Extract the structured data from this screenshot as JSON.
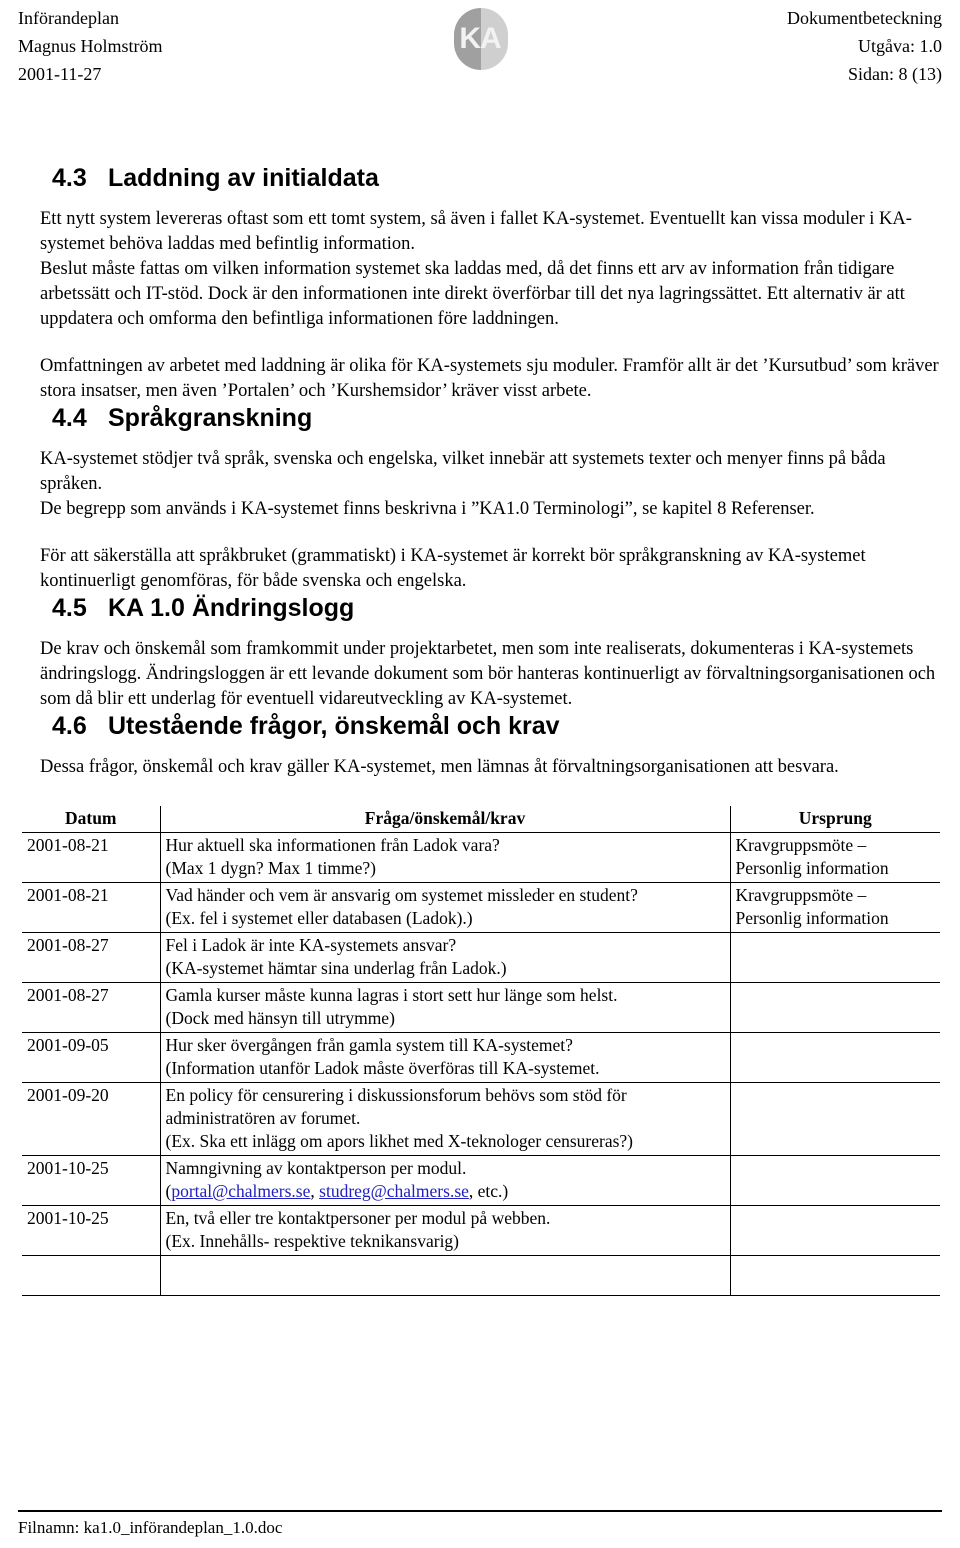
{
  "header": {
    "left_lines": [
      "Införandeplan",
      "Magnus Holmström",
      "2001-11-27"
    ],
    "right_lines": [
      "Dokumentbeteckning",
      "Utgåva: 1.0",
      "Sidan: 8 (13)"
    ],
    "logo_text": "KA",
    "logo_color": "#a0a0a0"
  },
  "sections": [
    {
      "number": "4.3",
      "title": "Laddning av initialdata",
      "paragraphs": [
        "Ett nytt system levereras oftast som ett tomt system, så även i fallet KA-systemet. Eventuellt kan vissa moduler i KA-systemet behöva laddas med befintlig information.",
        "Beslut måste fattas om vilken information systemet ska laddas med, då det finns ett arv av information från tidigare arbetssätt och IT-stöd. Dock är den informationen inte direkt överförbar till det nya lagringssättet. Ett alternativ är att uppdatera och omforma den befintliga informationen före laddningen.",
        "Omfattningen av arbetet med laddning är olika för KA-systemets sju moduler. Framför allt är det ’Kursutbud’ som kräver stora insatser, men även ’Portalen’ och ’Kurshemsidor’ kräver visst arbete."
      ]
    },
    {
      "number": "4.4",
      "title": "Språkgranskning",
      "paragraphs": [
        "KA-systemet stödjer två språk, svenska och engelska, vilket innebär att systemets texter och menyer finns på båda språken.",
        "De begrepp som används i KA-systemet finns beskrivna i ”KA1.0 Terminologi”, se kapitel 8 Referenser.",
        "För att säkerställa att språkbruket (grammatiskt) i KA-systemet är korrekt bör språkgranskning av KA-systemet kontinuerligt genomföras, för både svenska och engelska."
      ]
    },
    {
      "number": "4.5",
      "title": "KA 1.0 Ändringslogg",
      "paragraphs": [
        "De krav och önskemål som framkommit under projektarbetet, men som inte realiserats, dokumenteras i KA-systemets ändringslogg. Ändringsloggen är ett levande dokument som bör hanteras kontinuerligt av förvaltningsorganisationen och som då blir ett underlag för eventuell vidareutveckling av KA-systemet."
      ]
    },
    {
      "number": "4.6",
      "title": "Utestående frågor, önskemål och krav",
      "paragraphs": [
        "Dessa frågor, önskemål och krav gäller KA-systemet, men lämnas åt förvaltningsorganisationen att besvara."
      ]
    }
  ],
  "table": {
    "columns": [
      "Datum",
      "Fråga/önskemål/krav",
      "Ursprung"
    ],
    "rows": [
      {
        "date": "2001-08-21",
        "question_lines": [
          "Hur aktuell ska informationen från Ladok vara?",
          "(Max 1 dygn? Max 1 timme?)"
        ],
        "source_lines": [
          "Kravgruppsmöte –",
          "Personlig information"
        ]
      },
      {
        "date": "2001-08-21",
        "question_lines": [
          "Vad händer och vem är ansvarig om systemet missleder en student?",
          "(Ex. fel i systemet eller databasen (Ladok).)"
        ],
        "source_lines": [
          "Kravgruppsmöte –",
          "Personlig information"
        ]
      },
      {
        "date": "2001-08-27",
        "question_lines": [
          "Fel i Ladok är inte KA-systemets ansvar?",
          "(KA-systemet hämtar sina underlag från Ladok.)"
        ],
        "source_lines": []
      },
      {
        "date": "2001-08-27",
        "question_lines": [
          "Gamla kurser måste kunna lagras i stort sett hur länge som helst.",
          "(Dock med hänsyn till utrymme)"
        ],
        "source_lines": []
      },
      {
        "date": "2001-09-05",
        "question_lines": [
          "Hur sker övergången från gamla system till KA-systemet?",
          "(Information utanför Ladok måste överföras till KA-systemet."
        ],
        "source_lines": []
      },
      {
        "date": "2001-09-20",
        "question_lines": [
          "En policy för censurering i diskussionsforum behövs som stöd för",
          "administratören av forumet.",
          "(Ex. Ska ett inlägg om apors likhet med X-teknologer censureras?)"
        ],
        "source_lines": []
      },
      {
        "date": "2001-10-25",
        "question_lines": [
          "Namngivning av kontaktperson per modul."
        ],
        "question_link_line": {
          "prefix": "(",
          "link1": "portal@chalmers.se",
          "mid": ", ",
          "link2": "studreg@chalmers.se",
          "suffix": ", etc.)"
        },
        "source_lines": []
      },
      {
        "date": "2001-10-25",
        "question_lines": [
          "En, två eller tre kontaktpersoner per modul på webben.",
          "(Ex. Innehålls- respektive teknikansvarig)"
        ],
        "source_lines": []
      },
      {
        "date": "",
        "question_lines": [],
        "source_lines": []
      }
    ],
    "link_color": "#2020c0"
  },
  "footer": {
    "text": "Filnamn: ka1.0_införandeplan_1.0.doc"
  }
}
